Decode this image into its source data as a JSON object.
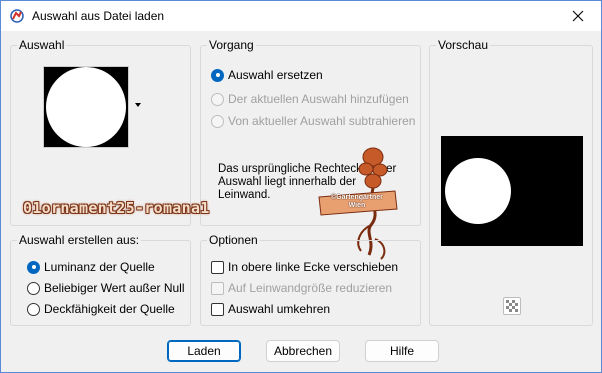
{
  "window": {
    "title": "Auswahl aus Datei laden",
    "close_icon": "close-icon",
    "app_icon": "paintshop-icon"
  },
  "auswahl_group": {
    "legend": "Auswahl",
    "dropdown_icon": "dropdown-arrow-icon"
  },
  "source_group": {
    "legend": "Auswahl erstellen aus:",
    "options": [
      "Luminanz der Quelle",
      "Beliebiger Wert außer Null",
      "Deckfähigkeit der Quelle"
    ],
    "selected": "Luminanz der Quelle"
  },
  "vorgang_group": {
    "legend": "Vorgang",
    "options": [
      "Auswahl ersetzen",
      "Der aktuellen Auswahl hinzufügen",
      "Von aktueller Auswahl subtrahieren"
    ],
    "selected": "Auswahl ersetzen",
    "disabled": [
      "Der aktuellen Auswahl hinzufügen",
      "Von aktueller Auswahl subtrahieren"
    ],
    "info_text": "Das ursprüngliche Rechteck dieser Auswahl liegt innerhalb der Leinwand."
  },
  "optionen_group": {
    "legend": "Optionen",
    "checkboxes": [
      {
        "label": "In obere linke Ecke verschieben",
        "checked": false,
        "disabled": false
      },
      {
        "label": "Auf Leinwandgröße reduzieren",
        "checked": false,
        "disabled": true
      },
      {
        "label": "Auswahl umkehren",
        "checked": false,
        "disabled": false
      }
    ]
  },
  "vorschau_group": {
    "legend": "Vorschau",
    "transparency_icon": "checkerboard-icon"
  },
  "overlay": {
    "label": "01ornament25-romana1",
    "watermark_line1": "©Gartengärtner",
    "watermark_line2": "Wien"
  },
  "buttons": {
    "ok": "Laden",
    "cancel": "Abbrechen",
    "help": "Hilfe"
  },
  "colors": {
    "accent": "#0067c0",
    "dialog_bg": "#f0f0f0",
    "preview_bg": "#000000",
    "ornament": "#b0471e"
  }
}
